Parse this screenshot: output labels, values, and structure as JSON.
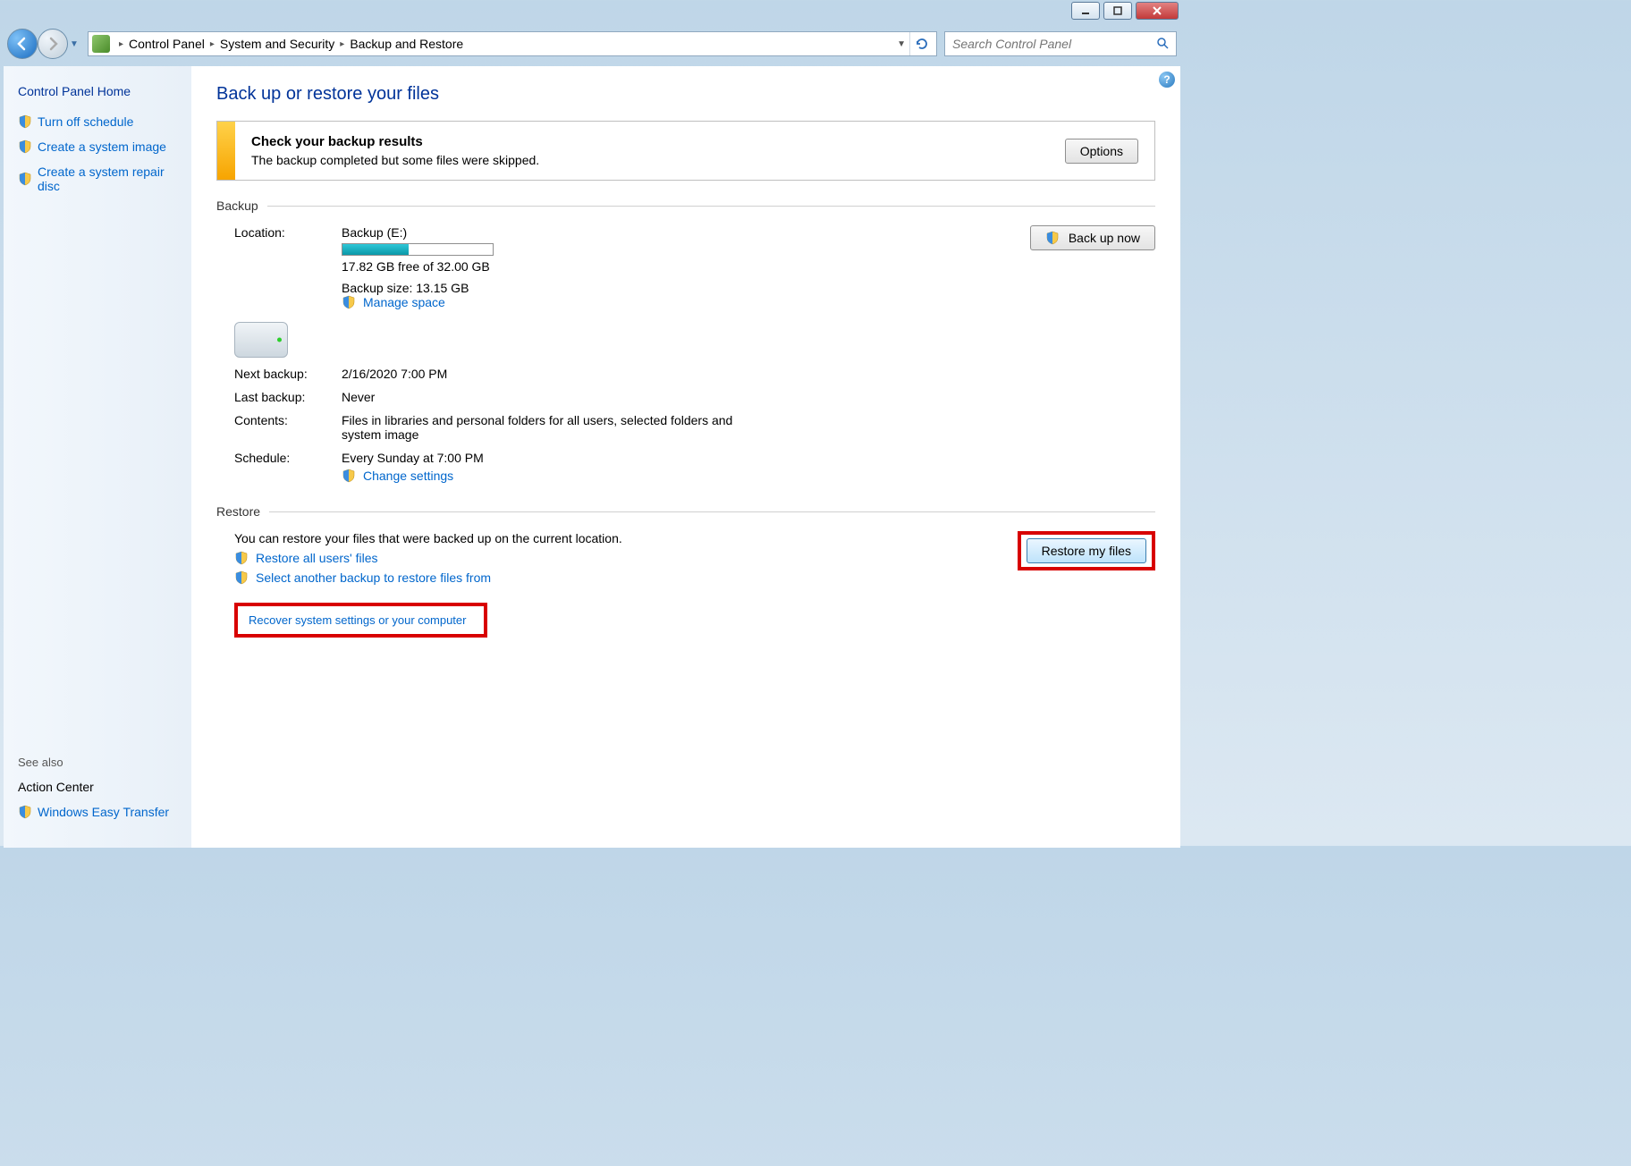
{
  "search": {
    "placeholder": "Search Control Panel"
  },
  "breadcrumb": {
    "0": "Control Panel",
    "1": "System and Security",
    "2": "Backup and Restore"
  },
  "sidebar": {
    "header": "Control Panel Home",
    "items": {
      "0": "Turn off schedule",
      "1": "Create a system image",
      "2": "Create a system repair disc"
    },
    "seealso": "See also",
    "action_center": "Action Center",
    "easy_transfer": "Windows Easy Transfer"
  },
  "page": {
    "title": "Back up or restore your files"
  },
  "alert": {
    "title": "Check your backup results",
    "desc": "The backup completed but some files were skipped.",
    "options_btn": "Options"
  },
  "backup": {
    "header": "Backup",
    "location_label": "Location:",
    "location_value": "Backup (E:)",
    "free_space": "17.82 GB free of 32.00 GB",
    "backup_size": "Backup size: 13.15 GB",
    "manage_space": "Manage space",
    "backup_now_btn": "Back up now",
    "next_label": "Next backup:",
    "next_value": "2/16/2020 7:00 PM",
    "last_label": "Last backup:",
    "last_value": "Never",
    "contents_label": "Contents:",
    "contents_value": "Files in libraries and personal folders for all users, selected folders and system image",
    "schedule_label": "Schedule:",
    "schedule_value": "Every Sunday at 7:00 PM",
    "change_settings": "Change settings"
  },
  "restore": {
    "header": "Restore",
    "desc": "You can restore your files that were backed up on the current location.",
    "restore_all": "Restore all users' files",
    "select_another": "Select another backup to restore files from",
    "restore_btn": "Restore my files",
    "recover": "Recover system settings or your computer"
  }
}
